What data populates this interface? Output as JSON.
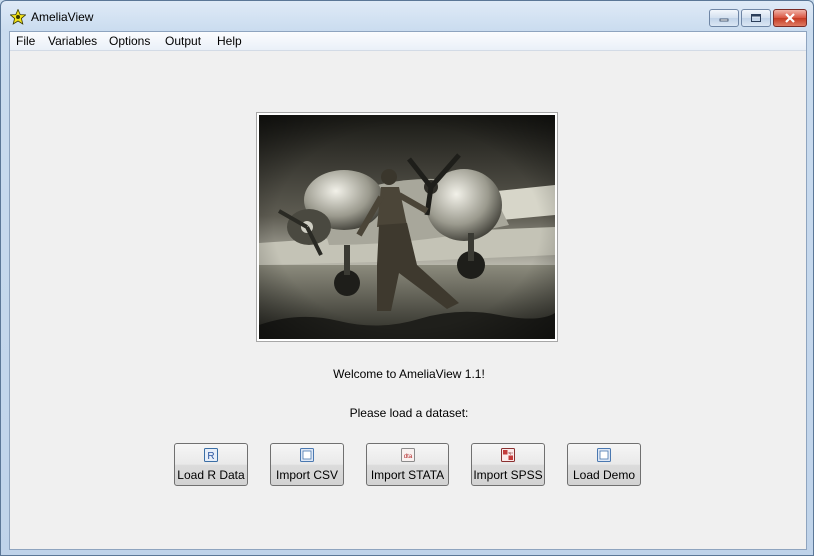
{
  "window": {
    "title": "AmeliaView",
    "icon": "star-app-icon"
  },
  "menu": {
    "items": [
      "File",
      "Variables",
      "Options",
      "Output",
      "Help"
    ]
  },
  "main": {
    "welcome": "Welcome to AmeliaView 1.1!",
    "prompt": "Please load a dataset:",
    "image": "black-and-white photo of aviator walking in front of a propeller airplane"
  },
  "buttons": [
    {
      "label": "Load R Data",
      "icon": "r-data-icon",
      "glyph": "R"
    },
    {
      "label": "Import CSV",
      "icon": "csv-icon",
      "glyph": ""
    },
    {
      "label": "Import STATA",
      "icon": "stata-icon",
      "glyph": "dta"
    },
    {
      "label": "Import SPSS",
      "icon": "spss-icon",
      "glyph": "sp"
    },
    {
      "label": "Load Demo",
      "icon": "demo-icon",
      "glyph": ""
    }
  ],
  "colors": {
    "accent": "#3a6ea5",
    "close": "#c43a22",
    "client_bg": "#f0f0f0"
  }
}
